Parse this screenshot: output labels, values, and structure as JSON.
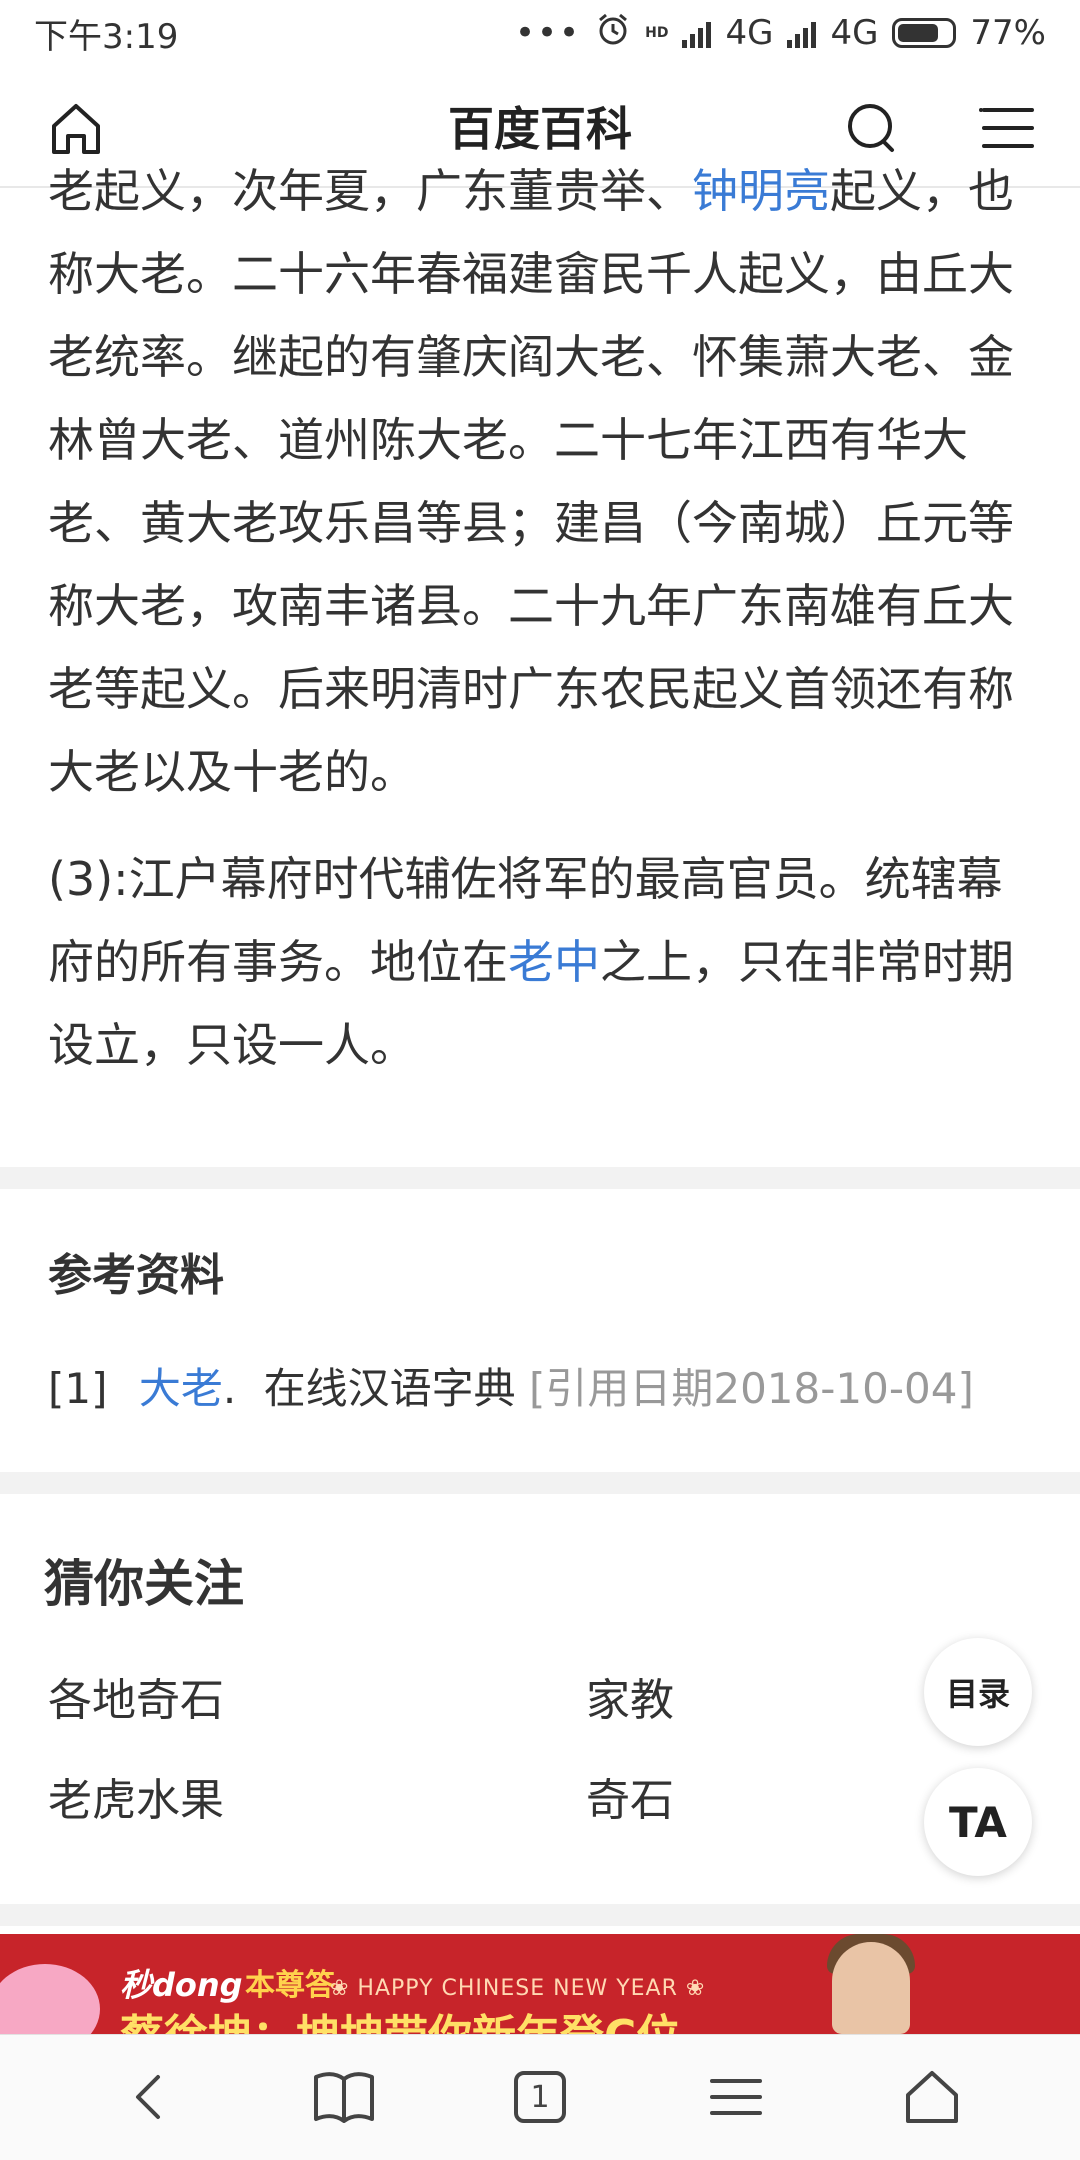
{
  "status_bar": {
    "time": "下午3:19",
    "dots": "•••",
    "hd": "HD",
    "net1": "4G",
    "net2": "4G",
    "battery": "77%",
    "battery_level": 0.77
  },
  "header": {
    "title": "百度百科"
  },
  "article": {
    "partial_top_before": "老起义，次年夏，广东董贵举、",
    "partial_top_link": "钟明亮",
    "partial_top_after": "起义，",
    "para1": "也称大老。二十六年春福建畲民千人起义，由丘大老统率。继起的有肇庆阎大老、怀集萧大老、金林曾大老、道州陈大老。二十七年江西有华大老、黄大老攻乐昌等县；建昌（今南城）丘元等称大老，攻南丰诸县。二十九年广东南雄有丘大老等起义。后来明清时广东农民起义首领还有称大老以及十老的。",
    "para2_before": "(3):江户幕府时代辅佐将军的最高官员。统辖幕府的所有事务。地位在",
    "para2_link": "老中",
    "para2_after": "之上，只在非常时期设立，只设一人。"
  },
  "references": {
    "title": "参考资料",
    "items": [
      {
        "index": "[1]",
        "link": "大老",
        "sep": ".",
        "source": "在线汉语字典",
        "date": "[引用日期2018-10-04]"
      }
    ]
  },
  "guess": {
    "title": "猜你关注",
    "items": [
      "各地奇石",
      "家教",
      "老虎水果",
      "奇石"
    ]
  },
  "floating": {
    "toc_label": "目录",
    "ta_label": "TA"
  },
  "banner": {
    "brand": "秒dong",
    "brand2": "本尊答",
    "tagline": "❀ HAPPY CHINESE NEW YEAR ❀",
    "slogan": "蔡徐坤：坤坤带你新年登C位"
  },
  "bottom_nav": {
    "tab_count": "1"
  }
}
